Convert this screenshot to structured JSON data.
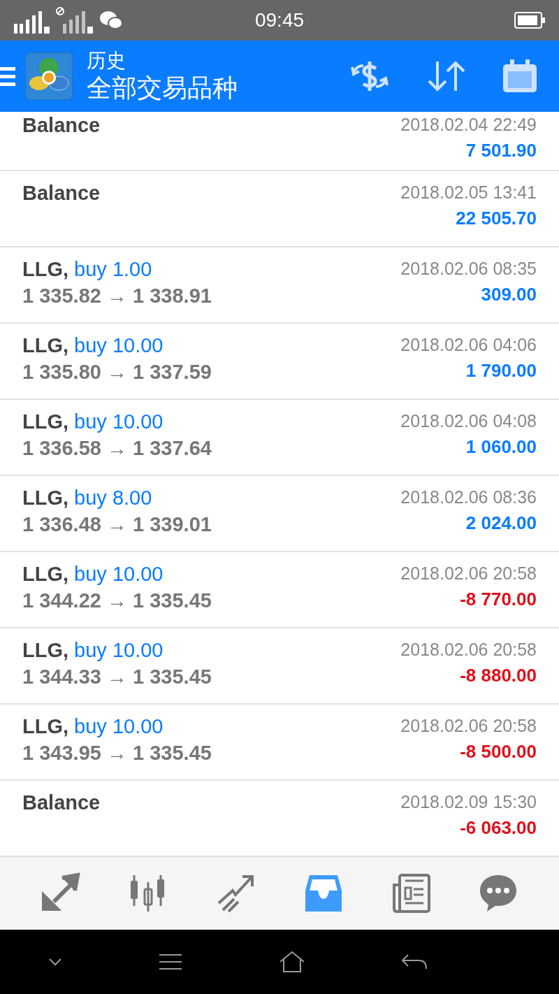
{
  "status_bar": {
    "time": "09:45"
  },
  "header": {
    "title": "历史",
    "subtitle": "全部交易品种"
  },
  "rows": [
    {
      "kind": "balance",
      "label": "Balance",
      "date": "2018.02.04 22:49",
      "profit": "7 501.90",
      "color": "#0a7cff"
    },
    {
      "kind": "balance",
      "label": "Balance",
      "date": "2018.02.05 13:41",
      "profit": "22 505.70",
      "color": "#0a7cff"
    },
    {
      "kind": "trade",
      "symbol": "LLG,",
      "side": "buy 1.00",
      "prices": "1 335.82 → 1 338.91",
      "date": "2018.02.06 08:35",
      "profit": "309.00",
      "color": "#0a7cff"
    },
    {
      "kind": "trade",
      "symbol": "LLG,",
      "side": "buy 10.00",
      "prices": "1 335.80 → 1 337.59",
      "date": "2018.02.06 04:06",
      "profit": "1 790.00",
      "color": "#0a7cff"
    },
    {
      "kind": "trade",
      "symbol": "LLG,",
      "side": "buy 10.00",
      "prices": "1 336.58 → 1 337.64",
      "date": "2018.02.06 04:08",
      "profit": "1 060.00",
      "color": "#0a7cff"
    },
    {
      "kind": "trade",
      "symbol": "LLG,",
      "side": "buy 8.00",
      "prices": "1 336.48 → 1 339.01",
      "date": "2018.02.06 08:36",
      "profit": "2 024.00",
      "color": "#0a7cff"
    },
    {
      "kind": "trade",
      "symbol": "LLG,",
      "side": "buy 10.00",
      "prices": "1 344.22 → 1 335.45",
      "date": "2018.02.06 20:58",
      "profit": "-8 770.00",
      "color": "#e0101a"
    },
    {
      "kind": "trade",
      "symbol": "LLG,",
      "side": "buy 10.00",
      "prices": "1 344.33 → 1 335.45",
      "date": "2018.02.06 20:58",
      "profit": "-8 880.00",
      "color": "#e0101a"
    },
    {
      "kind": "trade",
      "symbol": "LLG,",
      "side": "buy 10.00",
      "prices": "1 343.95 → 1 335.45",
      "date": "2018.02.06 20:58",
      "profit": "-8 500.00",
      "color": "#e0101a"
    },
    {
      "kind": "balance",
      "label": "Balance",
      "date": "2018.02.09 15:30",
      "profit": "-6 063.00",
      "color": "#e0101a"
    }
  ],
  "bottom_nav": [
    {
      "kind": "quotes",
      "selected": false
    },
    {
      "kind": "chart",
      "selected": false
    },
    {
      "kind": "trade",
      "selected": false
    },
    {
      "kind": "history",
      "selected": true
    },
    {
      "kind": "news",
      "selected": false
    },
    {
      "kind": "chat",
      "selected": false
    }
  ]
}
